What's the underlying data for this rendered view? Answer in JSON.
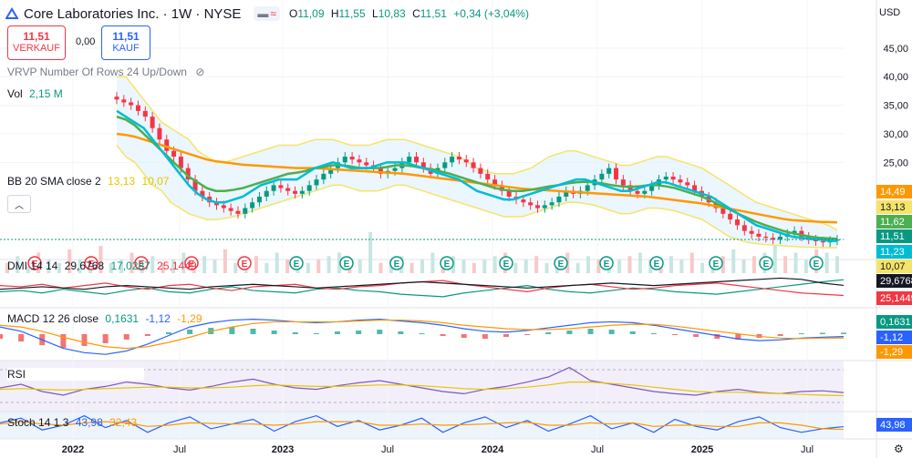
{
  "header": {
    "symbol_title": "Core Laboratories Inc. · 1W · NYSE",
    "open_label": "O",
    "open": "11,09",
    "high_label": "H",
    "high": "11,55",
    "low_label": "L",
    "low": "10,83",
    "close_label": "C",
    "close": "11,51",
    "change": "+0,34 (+3,04%)"
  },
  "trade": {
    "sell_price": "11,51",
    "sell_label": "VERKAUF",
    "spread": "0,00",
    "buy_price": "11,51",
    "buy_label": "KAUF"
  },
  "indicators": {
    "vrvp": "VRVP Number Of Rows 24 Up/Down",
    "vol_label": "Vol",
    "vol_value": "2,15 M",
    "bb_label": "BB 20 SMA close 2",
    "bb_v1": "13,13",
    "bb_v2": "10,07",
    "dmi_label": "DMI 14 14",
    "dmi_v1": "29,6768",
    "dmi_v2": "17,0287",
    "dmi_v3": "25,1449",
    "macd_label": "MACD 12 26 close",
    "macd_v1": "0,1631",
    "macd_v2": "-1,12",
    "macd_v3": "-1,29",
    "rsi_label": "RSI",
    "stoch_label": "Stoch 14 1 3",
    "stoch_v1": "43,98",
    "stoch_v2": "32,43"
  },
  "currency": "USD",
  "colors": {
    "up": "#089981",
    "down": "#f23645",
    "bb_band": "#f5e46a",
    "bb_fill": "#e3f2fd",
    "ma_fast": "#00bcd4",
    "ma_mid": "#4caf50",
    "ma_slow": "#ff9800",
    "volume": "#c8e6e1",
    "rsi_line": "#7e57c2",
    "stoch_k": "#2962ff",
    "stoch_d": "#ff9800"
  },
  "chart_data": {
    "type": "candlestick",
    "interval": "1W",
    "y_ticks": [
      "45,00",
      "40,00",
      "35,00",
      "30,00",
      "25,00"
    ],
    "y_range": [
      8,
      48
    ],
    "x_ticks": [
      "2022",
      "Jul",
      "2023",
      "Jul",
      "2024",
      "Jul",
      "2025",
      "Jul"
    ],
    "price_labels": [
      {
        "value": "14,49",
        "color": "#ff9800"
      },
      {
        "value": "13,13",
        "color": "#f5e46a"
      },
      {
        "value": "11,62",
        "color": "#4caf50"
      },
      {
        "value": "11,51",
        "color": "#089981"
      },
      {
        "value": "11,23",
        "color": "#00bcd4"
      },
      {
        "value": "10,07",
        "color": "#f5e46a"
      }
    ],
    "price_weekly": [
      36,
      35.5,
      35,
      34,
      33,
      31,
      29,
      27,
      26,
      24,
      22,
      20,
      19,
      18,
      17.5,
      17,
      16.5,
      16,
      17,
      18,
      19,
      20,
      21,
      20.5,
      20,
      19.5,
      20,
      21,
      22,
      23,
      24,
      25,
      26,
      25.5,
      25,
      24.5,
      24,
      23,
      23.5,
      24,
      25,
      26,
      25,
      24,
      23,
      24,
      25,
      26,
      25.5,
      25,
      24,
      23,
      22,
      21,
      20,
      19,
      18.5,
      18,
      17.5,
      17,
      17.5,
      18,
      19,
      20,
      19.5,
      20,
      21,
      22,
      23,
      24,
      22,
      21,
      20,
      19.5,
      20,
      21,
      22,
      22.5,
      22,
      21.5,
      21,
      20,
      19,
      18,
      17,
      16,
      15,
      14,
      13,
      12.5,
      12,
      11.8,
      11.5,
      12,
      12.5,
      13,
      12,
      11.5,
      11.2,
      11,
      11.3,
      11.51
    ],
    "ma_fast": [
      34,
      33,
      32,
      31,
      29,
      27,
      25,
      23,
      21,
      19.5,
      18.5,
      18,
      18,
      18.5,
      19,
      20,
      21,
      21.5,
      22,
      22,
      22,
      23,
      24,
      24.5,
      25,
      24.5,
      24,
      24,
      24,
      24.5,
      25,
      25,
      25,
      24.5,
      24,
      23.5,
      23,
      22.5,
      22,
      21,
      20,
      19.5,
      19,
      18.5,
      18.5,
      19,
      19.5,
      20,
      20.5,
      21,
      21.5,
      22,
      22,
      21.5,
      21,
      20.5,
      20,
      20,
      20.5,
      21,
      21.5,
      21.5,
      21,
      20.5,
      20,
      19.5,
      19,
      18,
      17,
      16,
      15,
      14,
      13.5,
      13,
      12.5,
      12,
      11.8,
      11.6,
      11.5,
      11.3,
      11.23
    ],
    "ma_mid": [
      33,
      32.5,
      31.5,
      30,
      28.5,
      27,
      25.5,
      24,
      22.5,
      21.5,
      20.5,
      20,
      20,
      20.2,
      20.5,
      21,
      21.5,
      22,
      22.5,
      23,
      23.2,
      23.5,
      24,
      24.2,
      24.5,
      24.5,
      24.3,
      24,
      24,
      24,
      24.2,
      24.5,
      24.5,
      24.3,
      24,
      23.8,
      23.4,
      23,
      22.5,
      22,
      21.5,
      21,
      20.5,
      20.2,
      20,
      20,
      20.2,
      20.5,
      20.8,
      21,
      21.3,
      21.5,
      21.6,
      21.5,
      21.3,
      21,
      20.8,
      20.7,
      20.8,
      21,
      21,
      20.8,
      20.5,
      20,
      19.5,
      19,
      18.3,
      17.5,
      16.8,
      16,
      15.3,
      14.6,
      14,
      13.5,
      13,
      12.6,
      12.3,
      12,
      11.8,
      11.7,
      11.62
    ],
    "ma_slow": [
      30,
      29.8,
      29.5,
      29,
      28.5,
      28,
      27.5,
      27,
      26.5,
      26,
      25.5,
      25.2,
      25,
      24.8,
      24.6,
      24.5,
      24.4,
      24.3,
      24.2,
      24.1,
      24,
      24,
      24,
      23.9,
      23.8,
      23.7,
      23.6,
      23.5,
      23.4,
      23.3,
      23.2,
      23.1,
      23,
      22.8,
      22.6,
      22.4,
      22.2,
      22,
      21.8,
      21.6,
      21.4,
      21.2,
      21,
      20.8,
      20.6,
      20.4,
      20.3,
      20.2,
      20.1,
      20,
      19.9,
      19.8,
      19.7,
      19.6,
      19.5,
      19.4,
      19.3,
      19.2,
      19.1,
      19,
      18.8,
      18.6,
      18.4,
      18.2,
      18,
      17.8,
      17.5,
      17.2,
      16.9,
      16.6,
      16.3,
      16,
      15.7,
      15.4,
      15.1,
      14.9,
      14.8,
      14.7,
      14.6,
      14.55,
      14.49
    ],
    "bb_upper": [
      40,
      40,
      38,
      36,
      34,
      32,
      31,
      30,
      29,
      27,
      26,
      25,
      25,
      25.5,
      26,
      26.5,
      27,
      27.5,
      28,
      28,
      28,
      28.5,
      29,
      29,
      29,
      28.5,
      28,
      28,
      28,
      28.5,
      29,
      29,
      29,
      28.5,
      28,
      27.5,
      27,
      26.5,
      26,
      25,
      24,
      23.5,
      23,
      23,
      23,
      23.5,
      24,
      25,
      26,
      26.5,
      27,
      27,
      26.5,
      26,
      25.5,
      25,
      24.5,
      24.5,
      25,
      25.5,
      26,
      26,
      25.5,
      25,
      24.5,
      24,
      23,
      22,
      21,
      20,
      19,
      18,
      17.5,
      17,
      16.5,
      16,
      15.5,
      15,
      14.5,
      14,
      13.13
    ],
    "bb_lower": [
      28,
      26,
      25,
      23,
      21,
      20,
      18,
      17,
      16,
      15.5,
      15,
      15,
      15.2,
      15.5,
      16,
      16.5,
      17,
      17.5,
      18,
      18.5,
      19,
      19.5,
      20,
      20.5,
      21,
      21,
      20.5,
      20,
      20,
      20,
      20.5,
      21,
      21,
      20.5,
      20,
      19.5,
      19,
      18.5,
      18,
      17.5,
      17,
      16.5,
      16,
      15.5,
      15.5,
      15.5,
      16,
      16.5,
      17,
      17.5,
      18,
      18,
      17.8,
      17.5,
      17,
      16.5,
      16,
      16,
      16.5,
      17,
      17,
      16.8,
      16.5,
      16,
      15.5,
      15,
      14,
      13,
      12,
      11.5,
      11,
      10.8,
      10.6,
      10.5,
      10.4,
      10.3,
      10.2,
      10.15,
      10.1,
      10.08,
      10.07
    ],
    "volume_weekly": [
      3,
      5,
      2,
      6,
      4,
      3,
      7,
      4,
      5,
      8,
      3,
      4,
      6,
      2,
      5,
      3,
      4,
      6,
      3,
      5,
      4,
      7,
      3,
      4,
      5,
      3,
      6,
      4,
      5,
      3,
      4,
      5,
      6,
      3,
      4,
      12,
      3,
      4,
      5,
      3,
      4,
      6,
      3,
      5,
      4,
      3,
      4,
      5,
      6,
      3,
      4,
      5,
      3,
      4,
      6,
      3,
      5,
      4,
      3,
      4,
      5,
      6,
      4,
      3,
      5,
      4,
      6,
      3,
      4,
      5,
      7,
      4,
      5,
      6,
      8,
      5,
      6,
      4,
      7,
      6,
      5
    ],
    "dmi_plus": [
      20,
      21,
      19,
      22,
      20,
      18,
      21,
      23,
      20,
      19,
      22,
      24,
      21,
      20,
      19,
      22,
      23,
      21,
      20,
      18,
      17,
      16,
      19,
      21,
      23,
      25,
      22,
      20,
      19,
      21,
      23,
      22,
      20,
      19,
      18,
      20,
      22,
      24,
      26,
      28,
      29.7
    ],
    "dmi_minus": [
      25,
      24,
      26,
      23,
      25,
      27,
      24,
      22,
      25,
      26,
      23,
      21,
      24,
      25,
      26,
      23,
      22,
      24,
      25,
      27,
      28,
      29,
      26,
      24,
      22,
      20,
      23,
      25,
      26,
      24,
      22,
      23,
      25,
      26,
      27,
      25,
      23,
      21,
      19,
      18,
      17.0
    ],
    "adx": [
      22,
      23,
      24,
      23,
      22,
      24,
      25,
      24,
      23,
      22,
      24,
      25,
      26,
      25,
      24,
      23,
      24,
      25,
      26,
      27,
      28,
      27,
      26,
      25,
      24,
      23,
      24,
      25,
      26,
      27,
      26,
      25,
      26,
      27,
      28,
      29,
      30,
      31,
      30,
      27,
      25.1
    ],
    "macd_hist": [
      -0.5,
      -0.8,
      -1.2,
      -1.5,
      -1.3,
      -1,
      -0.6,
      -0.2,
      0.2,
      0.5,
      0.7,
      0.8,
      0.6,
      0.4,
      0.2,
      0.1,
      0.3,
      0.4,
      0.5,
      0.3,
      0.1,
      -0.2,
      -0.4,
      -0.5,
      -0.3,
      -0.1,
      0.2,
      0.4,
      0.6,
      0.5,
      0.3,
      0.1,
      -0.1,
      -0.3,
      -0.5,
      -0.6,
      -0.4,
      -0.2,
      0.1,
      0.15,
      0.16
    ],
    "macd_line": [
      0,
      -0.5,
      -1.5,
      -2.5,
      -3,
      -3.2,
      -2.8,
      -2,
      -1,
      0,
      0.5,
      0.8,
      0.9,
      0.8,
      0.6,
      0.5,
      0.6,
      0.8,
      0.9,
      0.7,
      0.5,
      0.2,
      -0.2,
      -0.5,
      -0.6,
      -0.4,
      -0.1,
      0.2,
      0.5,
      0.6,
      0.5,
      0.2,
      -0.2,
      -0.6,
      -1,
      -1.4,
      -1.6,
      -1.5,
      -1.3,
      -1.2,
      -1.12
    ],
    "macd_signal": [
      0.2,
      0,
      -0.5,
      -1.2,
      -1.8,
      -2.3,
      -2.5,
      -2.3,
      -1.8,
      -1.2,
      -0.5,
      0,
      0.4,
      0.6,
      0.6,
      0.6,
      0.6,
      0.7,
      0.8,
      0.8,
      0.7,
      0.5,
      0.2,
      0,
      -0.2,
      -0.3,
      -0.3,
      -0.2,
      0,
      0.2,
      0.3,
      0.3,
      0.1,
      -0.2,
      -0.5,
      -0.8,
      -1.1,
      -1.3,
      -1.35,
      -1.3,
      -1.29
    ],
    "rsi": [
      50,
      55,
      45,
      40,
      48,
      52,
      58,
      55,
      50,
      47,
      52,
      58,
      62,
      55,
      50,
      48,
      53,
      57,
      60,
      55,
      50,
      45,
      42,
      48,
      52,
      58,
      65,
      78,
      60,
      55,
      50,
      45,
      42,
      40,
      45,
      48,
      44,
      42,
      45,
      46,
      43.62
    ],
    "rsi_ma": [
      48,
      49,
      48,
      47,
      48,
      49,
      50,
      51,
      51,
      50,
      50,
      51,
      53,
      54,
      53,
      52,
      52,
      53,
      54,
      54,
      53,
      51,
      49,
      48,
      49,
      51,
      54,
      58,
      58,
      56,
      54,
      51,
      48,
      45,
      44,
      44,
      43,
      42,
      41,
      40,
      39.37
    ],
    "stoch_k": [
      60,
      80,
      30,
      50,
      90,
      40,
      70,
      20,
      60,
      85,
      35,
      55,
      75,
      25,
      65,
      90,
      45,
      70,
      30,
      50,
      80,
      20,
      60,
      85,
      40,
      70,
      25,
      55,
      90,
      35,
      60,
      20,
      75,
      45,
      30,
      65,
      85,
      40,
      20,
      35,
      43.98
    ],
    "stoch_d": [
      55,
      65,
      55,
      50,
      60,
      65,
      60,
      45,
      50,
      60,
      58,
      55,
      55,
      50,
      55,
      65,
      65,
      65,
      50,
      50,
      55,
      50,
      52,
      55,
      60,
      62,
      50,
      50,
      60,
      55,
      60,
      45,
      50,
      50,
      45,
      45,
      60,
      60,
      50,
      35,
      32.43
    ]
  }
}
